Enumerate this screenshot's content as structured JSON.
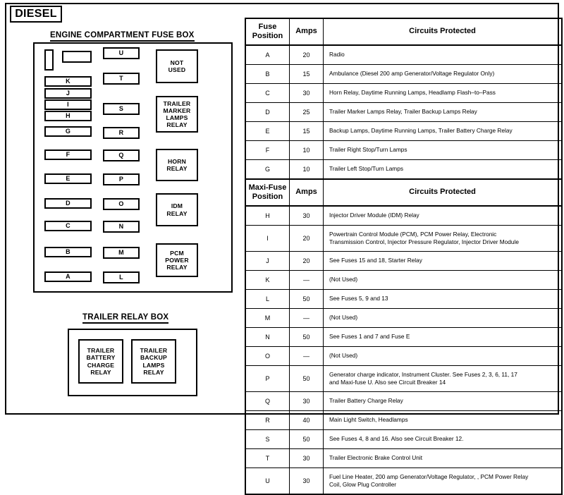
{
  "badge": {
    "label": "DIESEL"
  },
  "engine_box": {
    "title": "ENGINE COMPARTMENT FUSE BOX",
    "blank_cells": [
      {
        "name": "blank-fuse-slot-narrow",
        "label": ""
      },
      {
        "name": "blank-fuse-slot-wide",
        "label": ""
      }
    ],
    "column_left": [
      {
        "label": "K"
      },
      {
        "label": "J"
      },
      {
        "label": "I"
      },
      {
        "label": "H"
      },
      {
        "label": "G"
      },
      {
        "label": "F"
      },
      {
        "label": "E"
      },
      {
        "label": "D"
      },
      {
        "label": "C"
      },
      {
        "label": "B"
      },
      {
        "label": "A"
      }
    ],
    "column_middle": [
      {
        "label": "U"
      },
      {
        "label": "T"
      },
      {
        "label": "S"
      },
      {
        "label": "R"
      },
      {
        "label": "Q"
      },
      {
        "label": "P"
      },
      {
        "label": "O"
      },
      {
        "label": "N"
      },
      {
        "label": "M"
      },
      {
        "label": "L"
      }
    ],
    "column_right": [
      {
        "label": "NOT\nUSED"
      },
      {
        "label": "TRAILER\nMARKER\nLAMPS\nRELAY"
      },
      {
        "label": "HORN\nRELAY"
      },
      {
        "label": "IDM\nRELAY"
      },
      {
        "label": "PCM\nPOWER\nRELAY"
      }
    ]
  },
  "trailer_box": {
    "title": "TRAILER RELAY BOX",
    "relays": [
      {
        "label": "TRAILER\nBATTERY\nCHARGE\nRELAY"
      },
      {
        "label": "TRAILER\nBACKUP\nLAMPS\nRELAY"
      }
    ]
  },
  "table": {
    "header": {
      "position": "Fuse\nPosition",
      "amps": "Amps",
      "circuits": "Circuits Protected"
    },
    "section_header": {
      "position": "Maxi-Fuse\nPosition",
      "amps": "Amps",
      "circuits": "Circuits Protected"
    },
    "fuse_rows": [
      {
        "position": "A",
        "amps": "20",
        "circuits": "Radio"
      },
      {
        "position": "B",
        "amps": "15",
        "circuits": "Ambulance (Diesel 200 amp Generator/Voltage Regulator Only)"
      },
      {
        "position": "C",
        "amps": "30",
        "circuits": "Horn Relay, Daytime Running Lamps, Headlamp Flash–to–Pass"
      },
      {
        "position": "D",
        "amps": "25",
        "circuits": "Trailer Marker Lamps Relay, Trailer Backup Lamps Relay"
      },
      {
        "position": "E",
        "amps": "15",
        "circuits": "Backup Lamps, Daytime Running Lamps, Trailer Battery Charge Relay"
      },
      {
        "position": "F",
        "amps": "10",
        "circuits": "Trailer Right Stop/Turn Lamps"
      },
      {
        "position": "G",
        "amps": "10",
        "circuits": "Trailer Left Stop/Turn Lamps"
      }
    ],
    "maxi_rows": [
      {
        "position": "H",
        "amps": "30",
        "circuits": "Injector Driver Module (IDM) Relay",
        "tall": false
      },
      {
        "position": "I",
        "amps": "20",
        "circuits": "Powertrain Control Module (PCM), PCM Power Relay, Electronic\nTransmission Control, Injector Pressure Regulator, Injector Driver Module",
        "tall": true
      },
      {
        "position": "J",
        "amps": "20",
        "circuits": "See Fuses 15 and 18, Starter Relay",
        "tall": false
      },
      {
        "position": "K",
        "amps": "—",
        "circuits": "(Not  Used)",
        "tall": false
      },
      {
        "position": "L",
        "amps": "50",
        "circuits": "See Fuses 5, 9 and 13",
        "tall": false
      },
      {
        "position": "M",
        "amps": "—",
        "circuits": "(Not Used)",
        "tall": false
      },
      {
        "position": "N",
        "amps": "50",
        "circuits": "See Fuses 1 and 7 and Fuse E",
        "tall": false
      },
      {
        "position": "O",
        "amps": "—",
        "circuits": "(Not Used)",
        "tall": false
      },
      {
        "position": "P",
        "amps": "50",
        "circuits": "Generator charge indicator, Instrument Cluster. See Fuses 2, 3, 6, 11, 17\nand Maxi-fuse U. Also see Circuit Breaker 14",
        "tall": true
      },
      {
        "position": "Q",
        "amps": "30",
        "circuits": "Trailer Battery Charge Relay",
        "tall": false
      },
      {
        "position": "R",
        "amps": "40",
        "circuits": "Main Light Switch, Headlamps",
        "tall": false
      },
      {
        "position": "S",
        "amps": "50",
        "circuits": "See Fuses 4, 8 and 16. Also see Circuit Breaker 12.",
        "tall": false
      },
      {
        "position": "T",
        "amps": "30",
        "circuits": "Trailer Electronic Brake Control Unit",
        "tall": false
      },
      {
        "position": "U",
        "amps": "30",
        "circuits": "Fuel Line Heater, 200 amp Generator/Voltage Regulator, , PCM Power Relay\nCoil, Glow Plug Controller",
        "tall": true
      }
    ]
  }
}
